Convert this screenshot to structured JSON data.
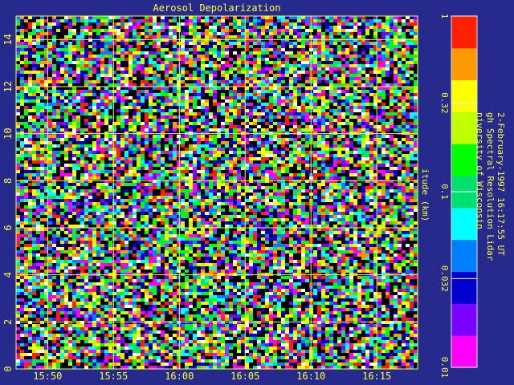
{
  "chart_data": {
    "type": "heatmap",
    "title": "Aerosol Depolarization",
    "xlabel": "",
    "ylabel": "itude (km)",
    "x_ticks": [
      "15:50",
      "15:55",
      "16:00",
      "16:05",
      "16:10",
      "16:15"
    ],
    "x_tick_minutes": [
      50,
      55,
      60,
      65,
      70,
      75
    ],
    "xlim_minutes": [
      47.6,
      78.1
    ],
    "y_ticks": [
      0,
      2,
      4,
      6,
      8,
      10,
      12,
      14
    ],
    "ylim": [
      0,
      15
    ],
    "grid": true,
    "colorbar": {
      "scale": "log",
      "range": [
        0.01,
        1
      ],
      "tick_labels": [
        "1",
        "0.32",
        "0.1",
        "0.032",
        "0.01"
      ],
      "tick_values": [
        1,
        0.32,
        0.1,
        0.032,
        0.01
      ]
    },
    "info_lines": [
      "niversity of Wisconsin",
      "gh Spectral Resolution Lidar",
      "2-February-1997 16:17:55 UT"
    ]
  },
  "colors": {
    "background": "#262a8c",
    "text": "#ffff3a",
    "grid": "#ffff3a",
    "colormap": [
      "#ff00ff",
      "#7a00ff",
      "#0000d0",
      "#0080ff",
      "#00ffff",
      "#00e070",
      "#00ff00",
      "#c0ff00",
      "#ffff00",
      "#ff9900",
      "#ff2000"
    ]
  }
}
